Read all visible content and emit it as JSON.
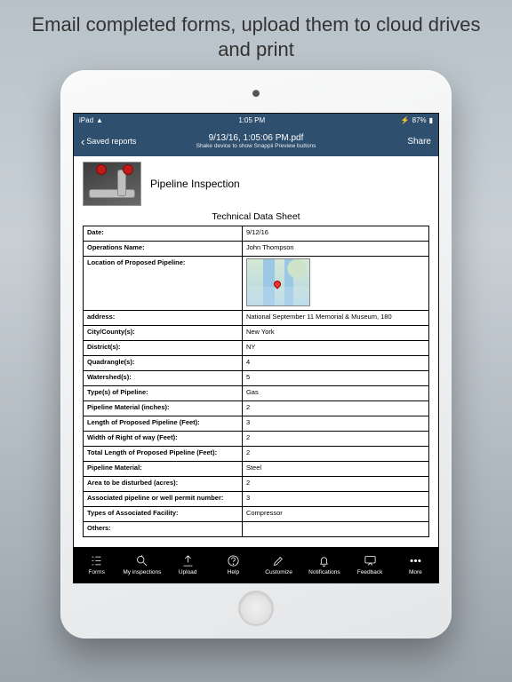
{
  "promo_text": "Email completed forms, upload them to cloud drives and print",
  "status": {
    "carrier": "iPad",
    "wifi": "●",
    "time": "1:05 PM",
    "battery": "87%",
    "charging": "⚡"
  },
  "nav": {
    "back_label": "Saved reports",
    "title": "9/13/16, 1:05:06 PM.pdf",
    "subtitle": "Shake device to show Snappii Preview buttons",
    "share": "Share"
  },
  "form": {
    "title": "Pipeline Inspection",
    "sheet_title": "Technical Data Sheet"
  },
  "rows": [
    {
      "label": "Date:",
      "value": "9/12/16"
    },
    {
      "label": "Operations Name:",
      "value": "John Thompson"
    },
    {
      "label": "Location of Proposed Pipeline:",
      "value": "__MAP__"
    },
    {
      "label": "address:",
      "value": "National September 11 Memorial & Museum, 180"
    },
    {
      "label": "City/County(s):",
      "value": "New York"
    },
    {
      "label": "District(s):",
      "value": "NY"
    },
    {
      "label": "Quadrangle(s):",
      "value": "4"
    },
    {
      "label": "Watershed(s):",
      "value": "5"
    },
    {
      "label": "Type(s) of Pipeline:",
      "value": "Gas"
    },
    {
      "label": "Pipeline Material (inches):",
      "value": "2"
    },
    {
      "label": "Length of Proposed Pipeline (Feet):",
      "value": "3"
    },
    {
      "label": "Width of Right of way (Feet):",
      "value": "2"
    },
    {
      "label": "Total Length of Proposed Pipeline (Feet):",
      "value": "2"
    },
    {
      "label": "Pipeline Material:",
      "value": "Steel"
    },
    {
      "label": "Area to be disturbed (acres):",
      "value": "2"
    },
    {
      "label": "Associated pipeline or well permit number:",
      "value": "3"
    },
    {
      "label": "Types of Associated Facility:",
      "value": "Compressor"
    },
    {
      "label": "Others:",
      "value": ""
    }
  ],
  "tabs": [
    "Forms",
    "My inspections",
    "Upload",
    "Help",
    "Customize",
    "Notifications",
    "Feedback",
    "More"
  ]
}
